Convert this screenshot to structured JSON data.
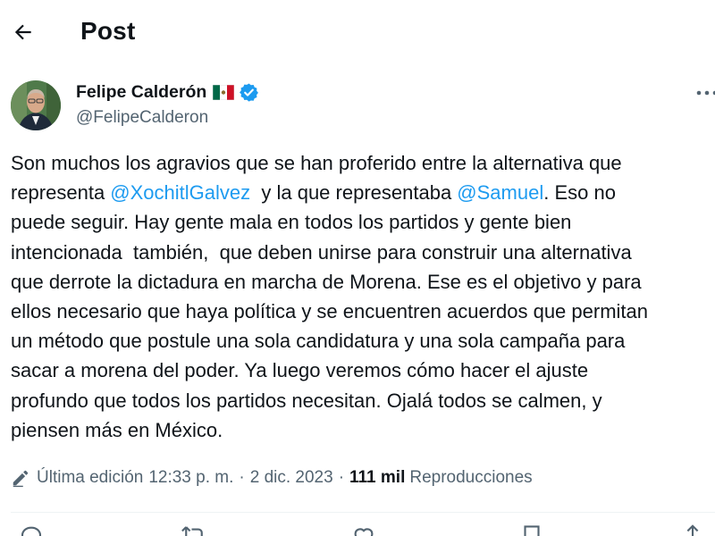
{
  "header": {
    "title": "Post",
    "back_icon": "arrow-left-icon"
  },
  "author": {
    "name": "Felipe Calderón",
    "handle": "@FelipeCalderon",
    "flag_icon": "mexico-flag-icon",
    "verified_icon": "verified-badge-icon",
    "more_icon": "more-horizontal-icon"
  },
  "post": {
    "lines": [
      [
        {
          "t": "Son muchos los agravios que se han proferido entre la alternativa que"
        }
      ],
      [
        {
          "t": "representa "
        },
        {
          "t": "@XochitlGalvez",
          "mention": true
        },
        {
          "t": "  y la que representaba "
        },
        {
          "t": "@Samuel",
          "mention": true
        },
        {
          "t": ". Eso no"
        }
      ],
      [
        {
          "t": "puede seguir. Hay gente mala en todos los partidos y gente bien"
        }
      ],
      [
        {
          "t": "intencionada  también,  que deben unirse para construir una alternativa"
        }
      ],
      [
        {
          "t": "que derrote la dictadura en marcha de Morena. Ese es el objetivo y para"
        }
      ],
      [
        {
          "t": "ellos necesario que haya política y se encuentren acuerdos que permitan"
        }
      ],
      [
        {
          "t": "un método que postule una sola candidatura y una sola campaña para"
        }
      ],
      [
        {
          "t": "sacar a morena del poder. Ya luego veremos cómo hacer el ajuste"
        }
      ],
      [
        {
          "t": "profundo que todos los partidos necesitan. Ojalá todos se calmen, y"
        }
      ],
      [
        {
          "t": "piensen más en México."
        }
      ]
    ]
  },
  "meta": {
    "edit_icon": "pencil-edit-icon",
    "edited_label": "Última edición",
    "time": "12:33 p. m.",
    "date": "2 dic. 2023",
    "views_count": "111 mil",
    "views_label": "Reproducciones",
    "separator": "·"
  },
  "actions": [
    {
      "icon": "reply-icon"
    },
    {
      "icon": "repost-icon"
    },
    {
      "icon": "like-icon"
    },
    {
      "icon": "bookmark-icon"
    },
    {
      "icon": "share-icon"
    }
  ],
  "colors": {
    "text": "#0f1419",
    "secondary": "#536471",
    "accent": "#1d9bf0",
    "divider": "#eff3f4"
  }
}
